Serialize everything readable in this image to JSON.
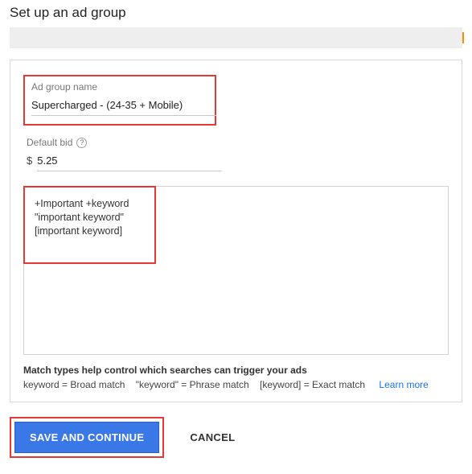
{
  "page": {
    "title": "Set up an ad group"
  },
  "adGroup": {
    "nameLabel": "Ad group name",
    "nameValue": "Supercharged - (24-35 + Mobile)"
  },
  "bid": {
    "label": "Default bid",
    "currency": "$",
    "value": "5.25"
  },
  "keywords": {
    "text": "+Important +keyword\n\"important keyword\"\n[important keyword]"
  },
  "matchHelp": {
    "heading": "Match types help control which searches can trigger your ads",
    "broad": "keyword = Broad match",
    "phrase": "\"keyword\" = Phrase match",
    "exact": "[keyword] = Exact match",
    "learnMore": "Learn more"
  },
  "buttons": {
    "save": "SAVE AND CONTINUE",
    "cancel": "CANCEL"
  }
}
